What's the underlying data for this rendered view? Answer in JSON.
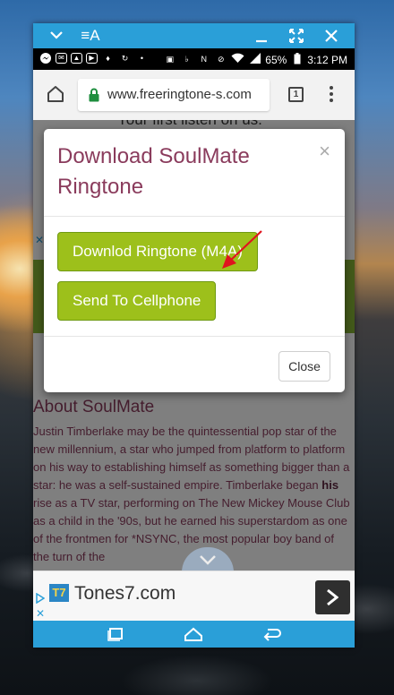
{
  "window_bar": {
    "font_toggle_label": "≡A"
  },
  "status_bar": {
    "battery": "65%",
    "time": "3:12 PM"
  },
  "browser": {
    "url": "www.freeringtone-s.com",
    "tab_count": "1"
  },
  "page": {
    "listen_text": "Your first listen on us.",
    "about_heading": "About SoulMate",
    "bio_parts": [
      "Justin Timberlake may be the quintessential pop star of the new millennium, a star who jumped from platform to platform on his way to establishing himself as something bigger than a star: he was a self-sustained empire. Timberlake began ",
      "his",
      " rise as a TV star, performing on The New Mickey Mouse Club as a child in the '90s, but he earned his superstardom as one of the frontmen for *NSYNC, the most popular boy band of the turn of the"
    ]
  },
  "modal": {
    "title": "Download SoulMate Ringtone",
    "close_x": "×",
    "download_button": "Downlod Ringtone (M4A)",
    "send_button": "Send To Cellphone",
    "close_button": "Close"
  },
  "ad": {
    "logo_text": "T7",
    "title": "Tones7.com",
    "close_x": "✕"
  },
  "colors": {
    "window_bar": "#2a9fd8",
    "modal_title": "#8a3b5c",
    "button_green": "#9dc01b",
    "arrow_red": "#e0141e"
  }
}
